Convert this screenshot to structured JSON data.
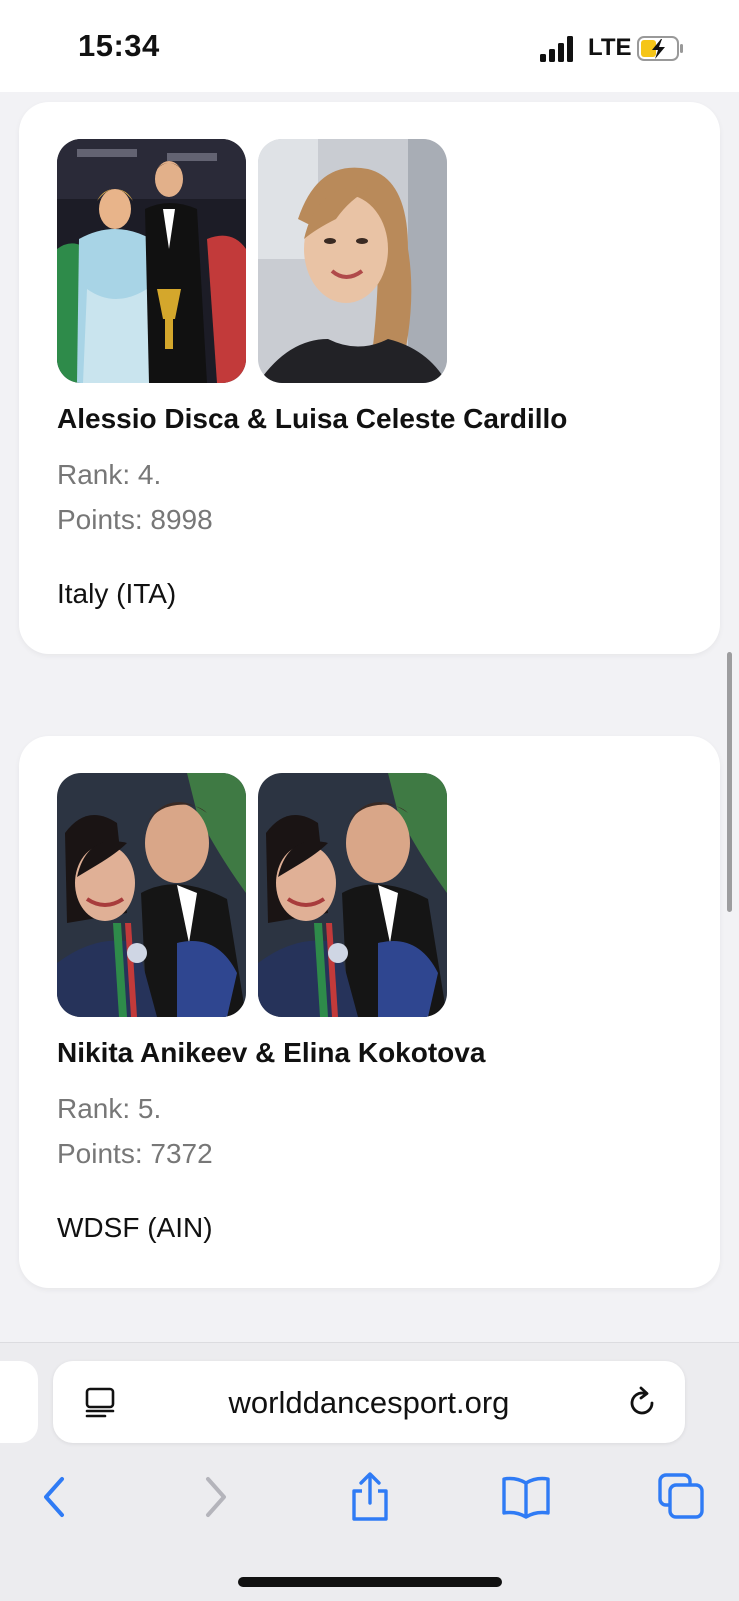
{
  "status_bar": {
    "time": "15:34",
    "network": "LTE"
  },
  "cards": [
    {
      "title": "Alessio Disca & Luisa Celeste Cardillo",
      "rank": "Rank: 4.",
      "points": "Points: 8998",
      "country": "Italy (ITA)"
    },
    {
      "title": "Nikita Anikeev & Elina Kokotova",
      "rank": "Rank: 5.",
      "points": "Points: 7372",
      "country": "WDSF (AIN)"
    }
  ],
  "browser": {
    "url": "worlddancesport.org"
  },
  "colors": {
    "accent": "#2f7bf5",
    "battery_fill": "#f5c518",
    "page_background": "#f2f2f5"
  },
  "icons": [
    "signal-icon",
    "battery-charging-icon",
    "reader-mode-icon",
    "reload-icon",
    "back-icon",
    "forward-icon",
    "share-icon",
    "bookmarks-icon",
    "tabs-icon"
  ]
}
